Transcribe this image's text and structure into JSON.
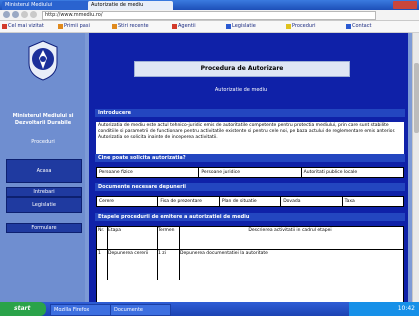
{
  "browser": {
    "tabs": [
      {
        "label": "Ministerul Mediului",
        "active": false
      },
      {
        "label": "Autorizatie de mediu",
        "active": true
      }
    ],
    "address": "http://www.mmediu.ro/",
    "bookmarks": [
      "Cel mai vizitat",
      "Primii pasi",
      "Stiri recente",
      "Agentii",
      "Legislatie",
      "Proceduri",
      "Contact"
    ]
  },
  "sidebar": {
    "title": "Ministerul Mediului si Dezvoltarii Durabile",
    "subtitle": "Proceduri",
    "buttons": [
      "Acasa",
      "Intrebari",
      "Legislatie",
      "Formulare"
    ]
  },
  "main": {
    "title": "Procedura de Autorizare",
    "subtitle": "Autorizatie de mediu",
    "sections": [
      "Introducere",
      "Cine poate solicita autorizatia?",
      "Documente necesare depunerii",
      "Etapele procedurii de emitere a autorizatiei de mediu"
    ],
    "intro_text": "Autorizatia de mediu este actul tehnico-juridic emis de autoritatile competente pentru protectia mediului, prin care sunt stabilite conditiile si parametrii de functionare pentru activitatile existente si pentru cele noi, pe baza actului de reglementare emis anterior. Autorizatia se solicita inainte de inceperea activitatii.",
    "row1": [
      "Persoane fizice",
      "Persoane juridice",
      "Autoritati publice locale"
    ],
    "row2": [
      "Cerere",
      "Fisa de prezentare",
      "Plan de situatie",
      "Dovada",
      "Taxa"
    ],
    "table_headers": [
      "Nr.",
      "Etapa",
      "Termen",
      "Descrierea activitatii in cadrul etapei"
    ],
    "table_row": [
      "1",
      "Depunerea cererii",
      "1 zi",
      "Depunerea documentatiei la autoritate"
    ]
  },
  "taskbar": {
    "start": "start",
    "tasks": [
      "Mozilla Firefox",
      "Documente"
    ],
    "clock": "10:42"
  },
  "colors": {
    "content_bg": "#0f21a8",
    "sidebar_bg": "#6f8ed0",
    "section_bg": "#2346c0"
  }
}
